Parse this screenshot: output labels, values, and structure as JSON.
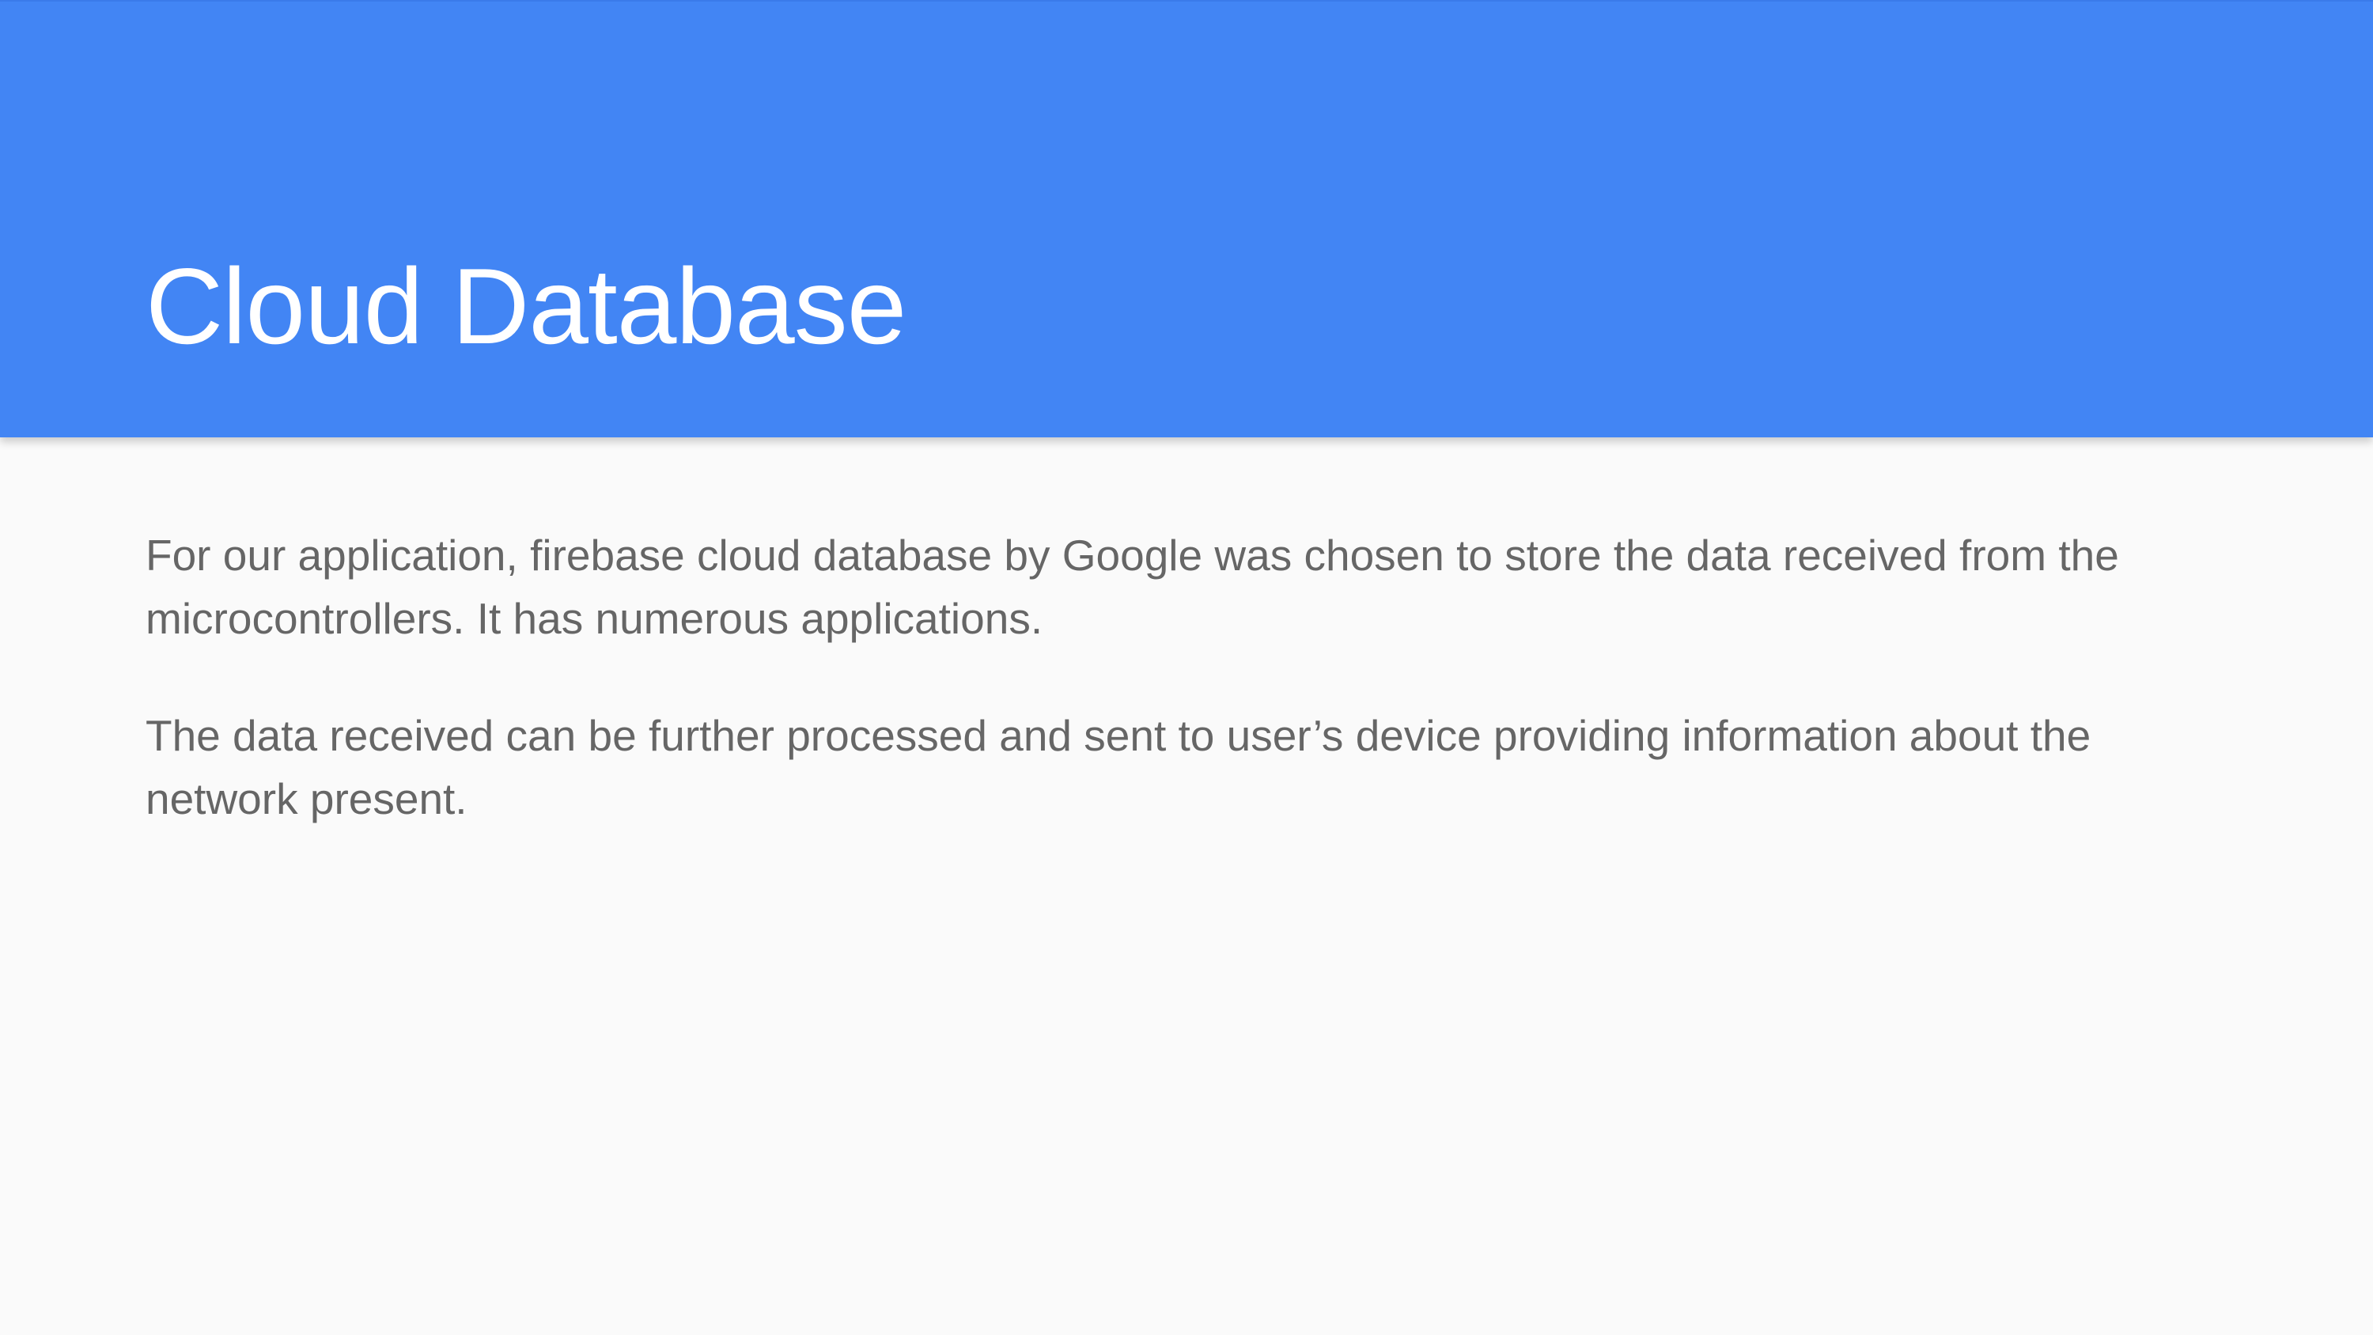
{
  "slide": {
    "title": "Cloud Database",
    "paragraphs": [
      "For our application, firebase cloud database by Google was chosen to store the data received from the microcontrollers. It has numerous applications.",
      "The data received can be further processed and sent to user’s device providing information about the network present."
    ]
  },
  "colors": {
    "header_band": "#4285f4",
    "title_text": "#ffffff",
    "body_text": "#666666",
    "background": "#fafafa"
  }
}
